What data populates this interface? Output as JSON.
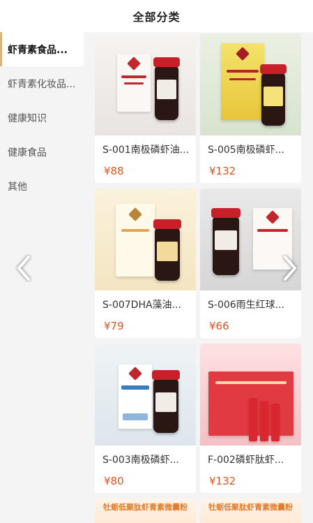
{
  "header": {
    "title": "全部分类"
  },
  "sidebar": {
    "items": [
      {
        "label": "虾青素食品...",
        "active": true
      },
      {
        "label": "虾青素化妆品...",
        "active": false
      },
      {
        "label": "健康知识",
        "active": false
      },
      {
        "label": "健康食品",
        "active": false
      },
      {
        "label": "其他",
        "active": false
      }
    ]
  },
  "products": [
    {
      "name": "S-001南极磷虾油...",
      "price": "¥88"
    },
    {
      "name": "S-005南极磷虾...",
      "price": "¥132"
    },
    {
      "name": "S-007DHA藻油...",
      "price": "¥79"
    },
    {
      "name": "S-006雨生红球...",
      "price": "¥66"
    },
    {
      "name": "S-003南极磷虾...",
      "price": "¥80"
    },
    {
      "name": "F-002磷虾肽虾...",
      "price": "¥132"
    }
  ],
  "partial_banners": [
    {
      "text": "牡蛎低聚肽虾青素微囊粉"
    },
    {
      "text": "牡蛎低聚肽虾青素微囊粉"
    }
  ],
  "carousel": {
    "prev_icon": "chevron-left-icon",
    "next_icon": "chevron-right-icon"
  },
  "colors": {
    "accent": "#d8b37a",
    "price": "#e0521e"
  }
}
